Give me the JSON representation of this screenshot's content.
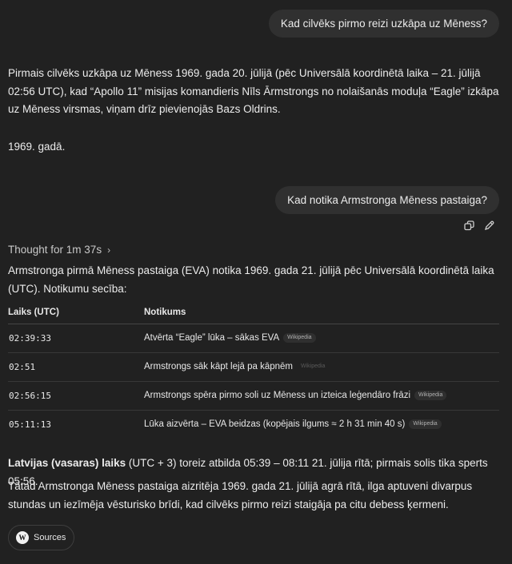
{
  "conversation": {
    "q1": "Kad cilvēks pirmo reizi uzkāpa uz Mēness?",
    "a1": "Pirmais cilvēks uzkāpa uz Mēness 1969. gada 20. jūlijā (pēc Universālā koordinētā laika – 21. jūlijā 02:56 UTC), kad “Apollo 11” misijas komandieris Nīls Ārmstrongs no nolaišanās moduļa “Eagle” izkāpa uz Mēness virsmas, viņam drīz pievienojās Bazs Oldrins.",
    "a1_year": "1969. gadā.",
    "q2": "Kad notika Armstronga Mēness pastaiga?",
    "thought_label": "Thought for 1m 37s",
    "intro": "Armstronga pirmā Mēness pastaiga (EVA) notika 1969. gada 21. jūlijā pēc Universālā koordinētā laika (UTC). Notikumu secība:",
    "table": {
      "headers": [
        "Laiks (UTC)",
        "Notikums"
      ],
      "rows": [
        {
          "time": "02:39:33",
          "event": "Atvērta “Eagle” lūka – sākas EVA",
          "source": "Wikipedia"
        },
        {
          "time": "02:51",
          "event": "Armstrongs sāk kāpt lejā pa kāpnēm",
          "source": "Wikipedia"
        },
        {
          "time": "02:56:15",
          "event": "Armstrongs spēra pirmo soli uz Mēness un izteica leģendāro frāzi",
          "source": "Wikipedia"
        },
        {
          "time": "05:11:13",
          "event": "Lūka aizvērta – EVA beidzas (kopējais ilgums ≈ 2 h 31 min 40 s)",
          "source": "Wikipedia"
        }
      ]
    },
    "latvia_bold": "Latvijas (vasaras) laiks",
    "latvia_rest": " (UTC + 3) toreiz atbilda 05:39 – 08:11 21. jūlija rītā; pirmais solis tika sperts 05:56.",
    "conclusion": "Tātad Armstronga Mēness pastaiga aizritēja 1969. gada 21. jūlijā agrā rītā, ilga aptuveni divarpus stundas un iezīmēja vēsturisko brīdi, kad cilvēks pirmo reizi staigāja pa citu debess ķermeni.",
    "sources_label": "Sources",
    "sources_logo": "W"
  }
}
